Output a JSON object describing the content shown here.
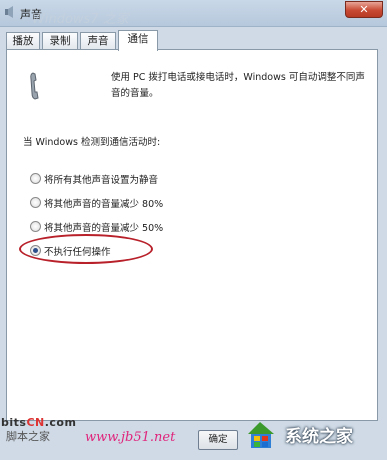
{
  "window": {
    "title": "声音",
    "close_symbol": "✕"
  },
  "tabs": [
    {
      "label": "播放",
      "active": false
    },
    {
      "label": "录制",
      "active": false
    },
    {
      "label": "声音",
      "active": false
    },
    {
      "label": "通信",
      "active": true
    }
  ],
  "panel": {
    "description": "使用 PC 拨打电话或接电话时，Windows 可自动调整不同声音的音量。",
    "section_label": "当 Windows 检测到通信活动时:",
    "options": [
      {
        "label": "将所有其他声音设置为静音",
        "checked": false
      },
      {
        "label": "将其他声音的音量减少 80%",
        "checked": false
      },
      {
        "label": "将其他声音的音量减少 50%",
        "checked": false
      },
      {
        "label": "不执行任何操作",
        "checked": true
      }
    ],
    "highlight_color": "#b8202a"
  },
  "buttons": {
    "ok": "确定"
  },
  "watermarks": {
    "top_faint": "Windows7 之家",
    "bits_prefix": "bits",
    "bits_cn": "CN",
    "bits_suffix": ".com",
    "jiaoben": "脚本之家",
    "url": "www.jb51.net",
    "brand": "系统之家"
  },
  "icons": {
    "app": "speaker-icon",
    "phone": "phone-handset-icon",
    "brand_logo": "windows-flag-icon"
  },
  "colors": {
    "url": "#e0257c",
    "title_bar": "#b6c8dc",
    "close": "#c84a34"
  }
}
